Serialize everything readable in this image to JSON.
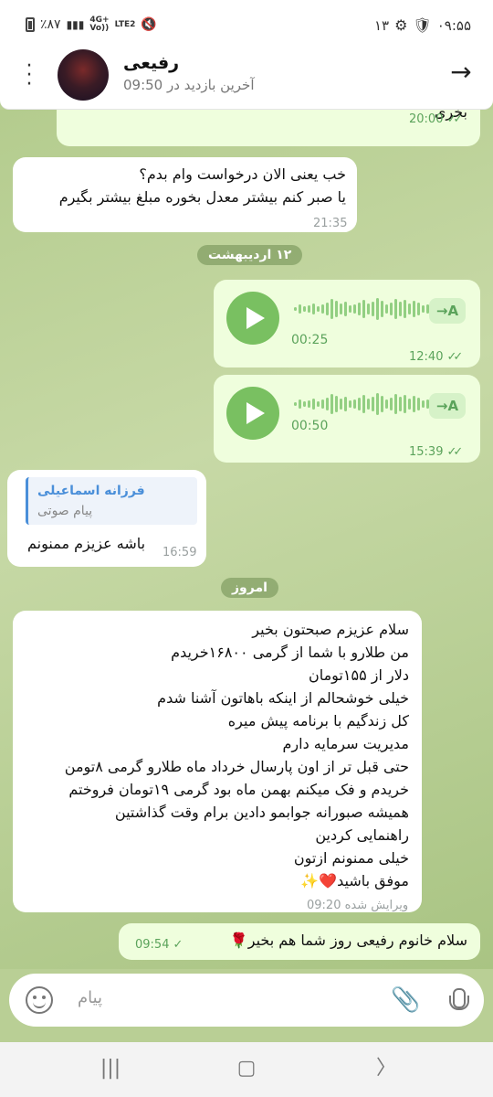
{
  "status_bar": {
    "time": "۰۹:۵۵",
    "notification_count": "۱۳",
    "battery": "٪۸۷",
    "network_4g": "4G+",
    "network_volte": "Vo))",
    "network_lte": "LTE2"
  },
  "header": {
    "contact_name": "رفیعی",
    "last_seen": "آخرین بازدید در 09:50"
  },
  "messages": {
    "m0": {
      "text": "بخری",
      "time": "20:00"
    },
    "m1": {
      "line1": "خب یعنی الان درخواست وام بدم؟",
      "line2": "یا صبر کنم بیشتر معدل بخوره مبلغ بیشتر بگیرم",
      "time": "21:35"
    },
    "date1": "۱۲ اردیبهشت",
    "v1": {
      "duration": "00:25",
      "time": "12:40",
      "transcribe": "→A"
    },
    "v2": {
      "duration": "00:50",
      "time": "15:39",
      "transcribe": "→A"
    },
    "r1": {
      "reply_name": "فرزانه اسماعیلی",
      "reply_text": "پیام صوتی",
      "text": "باشه عزیزم ممنونم",
      "time": "16:59"
    },
    "date2": "امروز",
    "long": {
      "lines": [
        "سلام عزیزم صبحتون بخیر",
        "من طلارو با شما از گرمی ۱۶۸۰۰خریدم",
        "دلار از ۱۵۵تومان",
        "خیلی خوشحالم از اینکه باهاتون آشنا شدم",
        "کل زندگیم با برنامه پیش میره",
        "مدیریت سرمایه دارم",
        "حتی قبل تر از اون پارسال خرداد ماه طلارو گرمی ۸تومن",
        "خریدم و فک میکنم بهمن ماه بود گرمی ۱۹تومان فروختم",
        "همیشه صبورانه جوابمو دادین برام وقت گذاشتین",
        "راهنمایی کردین",
        "خیلی ممنونم ازتون",
        "موفق باشید❤️✨"
      ],
      "edited_time": "ویرایش شده 09:20"
    },
    "last": {
      "text": "سلام خانوم رفیعی روز شما هم بخیر🌹",
      "time": "09:54"
    }
  },
  "input": {
    "placeholder": "پیام"
  },
  "colors": {
    "accent": "#79c061",
    "outgoing_bubble": "#effedd",
    "reply_bar": "#4a8fd9"
  }
}
